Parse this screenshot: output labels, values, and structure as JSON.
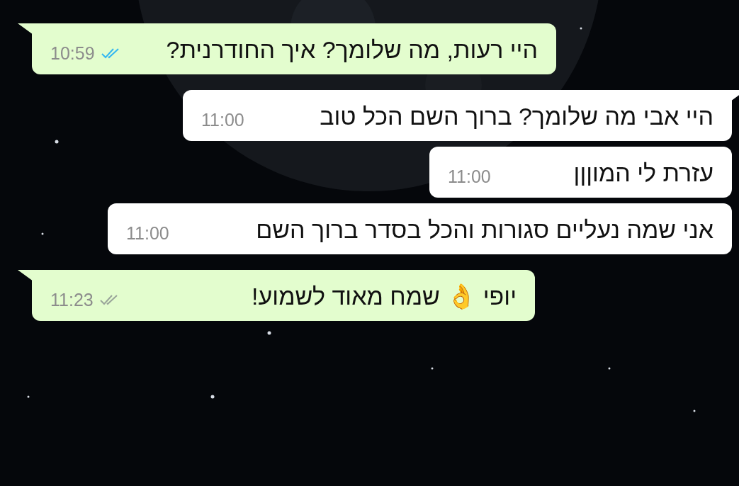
{
  "messages": [
    {
      "kind": "outgoing",
      "text": "היי רעות, מה שלומך? איך החודרנית?",
      "time": "10:59",
      "read": true,
      "tail": true
    },
    {
      "kind": "incoming",
      "text": "היי אבי מה שלומך? ברוך השם הכל טוב",
      "time": "11:00",
      "tail": true
    },
    {
      "kind": "incoming",
      "text": "עזרת לי המוןןן",
      "time": "11:00",
      "tail": false
    },
    {
      "kind": "incoming",
      "text": "אני שמה נעליים סגורות והכל בסדר ברוך השם",
      "time": "11:00",
      "tail": false
    },
    {
      "kind": "outgoing",
      "text": "יופי 👌 שמח מאוד לשמוע!",
      "time": "11:23",
      "read": false,
      "tail": true
    }
  ]
}
